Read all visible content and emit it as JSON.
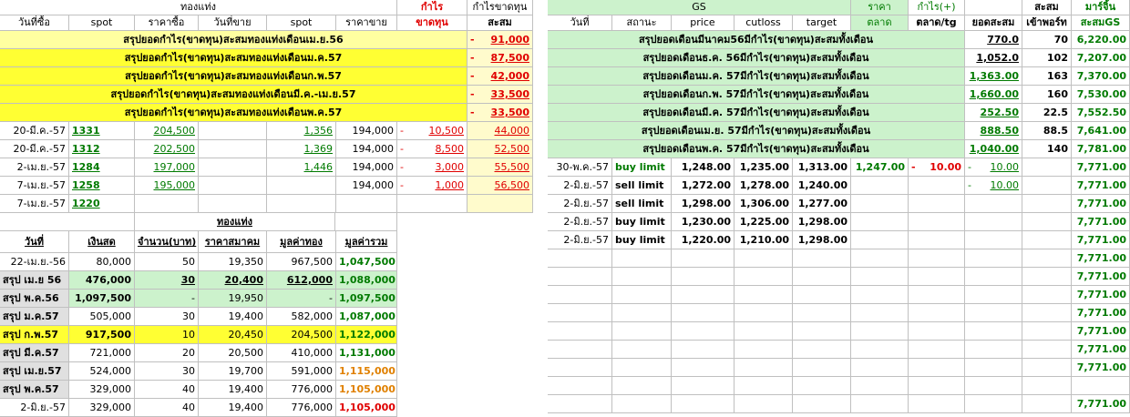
{
  "header": {
    "gold_bar": "ทองแท่ง",
    "profit": "กำไร",
    "profit_loss": "กำไรขาดทุน",
    "gs": "GS",
    "price": "ราคา",
    "profit_plus": "กำไร(+)",
    "accumulate": "สะสม",
    "margin": "มาร์จิ้น",
    "buy_date": "วันที่ซื้อ",
    "spot": "spot",
    "buy_price": "ราคาซื้อ",
    "sell_date": "วันที่ขาย",
    "spot2": "spot",
    "sell_price": "ราคาขาย",
    "loss": "ขาดทุน",
    "accum": "สะสม",
    "date": "วันที่",
    "status": "สถานะ",
    "price_en": "price",
    "cutloss": "cutloss",
    "target": "target",
    "market": "ตลาด",
    "market_tg": "ตลาด/tg",
    "total_accum": "ยอดสะสม",
    "entry_port": "เข้าพอร์ท",
    "accum_gs": "สะสมGS"
  },
  "left_summary": [
    {
      "text": "สรุปยอดกำไร(ขาดทุน)สะสมทองแท่งเดือนเม.ย.56",
      "sign": "-",
      "value": "91,000"
    },
    {
      "text": "สรุปยอดกำไร(ขาดทุน)สะสมทองแท่งเดือนม.ค.57",
      "sign": "-",
      "value": "87,500"
    },
    {
      "text": "สรุปยอดกำไร(ขาดทุน)สะสมทองแท่งเดือนก.พ.57",
      "sign": "-",
      "value": "42,000"
    },
    {
      "text": "สรุปยอดกำไร(ขาดทุน)สะสมทองแท่งเดือนมี.ค.-เม.ย.57",
      "sign": "-",
      "value": "33,500"
    },
    {
      "text": "สรุปยอดกำไร(ขาดทุน)สะสมทองแท่งเดือนพ.ค.57",
      "sign": "-",
      "value": "33,500"
    }
  ],
  "left_trades": [
    {
      "date": "20-มี.ค.-57",
      "spot": "1331",
      "buy": "204,500",
      "sell_date": "",
      "spot2": "1,356",
      "sell": "194,000",
      "sign": "-",
      "pl": "10,500",
      "acc": "44,000"
    },
    {
      "date": "20-มี.ค.-57",
      "spot": "1312",
      "buy": "202,500",
      "sell_date": "",
      "spot2": "1,369",
      "sell": "194,000",
      "sign": "-",
      "pl": "8,500",
      "acc": "52,500"
    },
    {
      "date": "2-เม.ย.-57",
      "spot": "1284",
      "buy": "197,000",
      "sell_date": "",
      "spot2": "1,446",
      "sell": "194,000",
      "sign": "-",
      "pl": "3,000",
      "acc": "55,500"
    },
    {
      "date": "7-เม.ย.-57",
      "spot": "1258",
      "buy": "195,000",
      "sell_date": "",
      "spot2": "",
      "sell": "194,000",
      "sign": "-",
      "pl": "1,000",
      "acc": "56,500"
    },
    {
      "date": "7-เม.ย.-57",
      "spot": "1220",
      "buy": "",
      "sell_date": "",
      "spot2": "",
      "sell": "",
      "sign": "",
      "pl": "",
      "acc": ""
    }
  ],
  "portfolio": {
    "title": "ทองแท่ง",
    "headers": [
      "วันที่",
      "เงินสด",
      "จำนวน(บาท)",
      "ราคาสมาคม",
      "มูลค่าทอง",
      "มูลค่ารวม"
    ],
    "rows": [
      {
        "label": "22-เม.ย.-56",
        "cash": "80,000",
        "qty": "50",
        "price": "19,350",
        "gold": "967,500",
        "total": "1,047,500"
      },
      {
        "label": "สรุป เม.ย 56",
        "cash": "476,000",
        "qty": "30",
        "price": "20,400",
        "gold": "612,000",
        "total": "1,088,000"
      },
      {
        "label": "สรุป พ.ค.56",
        "cash": "1,097,500",
        "qty": "-",
        "price": "19,950",
        "gold": "-",
        "total": "1,097,500"
      },
      {
        "label": "สรุป ม.ค.57",
        "cash": "505,000",
        "qty": "30",
        "price": "19,400",
        "gold": "582,000",
        "total": "1,087,000"
      },
      {
        "label": "สรุป ก.พ.57",
        "cash": "917,500",
        "qty": "10",
        "price": "20,450",
        "gold": "204,500",
        "total": "1,122,000"
      },
      {
        "label": "สรุป มี.ค.57",
        "cash": "721,000",
        "qty": "20",
        "price": "20,500",
        "gold": "410,000",
        "total": "1,131,000"
      },
      {
        "label": "สรุป เม.ย.57",
        "cash": "524,000",
        "qty": "30",
        "price": "19,700",
        "gold": "591,000",
        "total": "1,115,000"
      },
      {
        "label": "สรุป พ.ค.57",
        "cash": "329,000",
        "qty": "40",
        "price": "19,400",
        "gold": "776,000",
        "total": "1,105,000"
      },
      {
        "label": "2-มิ.ย.-57",
        "cash": "329,000",
        "qty": "40",
        "price": "19,400",
        "gold": "776,000",
        "total": "1,105,000"
      }
    ]
  },
  "right_summary": [
    {
      "text": "สรุปยอดเดือนมีนาคม56มีกำไร(ขาดทุน)สะสมทั้งเดือน",
      "total": "770.0",
      "entry": "70",
      "gs": "6,220.00"
    },
    {
      "text": "สรุปยอดเดือนธ.ค. 56มีกำไร(ขาดทุน)สะสมทั้งเดือน",
      "total": "1,052.0",
      "entry": "102",
      "gs": "7,207.00"
    },
    {
      "text": "สรุปยอดเดือนม.ค. 57มีกำไร(ขาดทุน)สะสมทั้งเดือน",
      "total": "1,363.00",
      "entry": "163",
      "gs": "7,370.00"
    },
    {
      "text": "สรุปยอดเดือนก.พ. 57มีกำไร(ขาดทุน)สะสมทั้งเดือน",
      "total": "1,660.00",
      "entry": "160",
      "gs": "7,530.00"
    },
    {
      "text": "สรุปยอดเดือนมี.ค. 57มีกำไร(ขาดทุน)สะสมทั้งเดือน",
      "total": "252.50",
      "entry": "22.5",
      "gs": "7,552.50"
    },
    {
      "text": "สรุปยอดเดือนเม.ย. 57มีกำไร(ขาดทุน)สะสมทั้งเดือน",
      "total": "888.50",
      "entry": "88.5",
      "gs": "7,641.00"
    },
    {
      "text": "สรุปยอดเดือนพ.ค. 57มีกำไร(ขาดทุน)สะสมทั้งเดือน",
      "total": "1,040.00",
      "entry": "140",
      "gs": "7,781.00"
    }
  ],
  "right_orders": [
    {
      "date": "30-พ.ค.-57",
      "status": "buy limit",
      "price": "1,248.00",
      "cutloss": "1,235.00",
      "target": "1,313.00",
      "market": "1,247.00",
      "sign": "-",
      "mtg": "10.00",
      "sign2": "-",
      "total": "10.00",
      "gs": "7,771.00"
    },
    {
      "date": "2-มิ.ย.-57",
      "status": "sell limit",
      "price": "1,272.00",
      "cutloss": "1,278.00",
      "target": "1,240.00",
      "market": "",
      "sign": "",
      "mtg": "",
      "sign2": "-",
      "total": "10.00",
      "gs": "7,771.00"
    },
    {
      "date": "2-มิ.ย.-57",
      "status": "sell limit",
      "price": "1,298.00",
      "cutloss": "1,306.00",
      "target": "1,277.00",
      "market": "",
      "sign": "",
      "mtg": "",
      "sign2": "",
      "total": "",
      "gs": "7,771.00"
    },
    {
      "date": "2-มิ.ย.-57",
      "status": "buy limit",
      "price": "1,230.00",
      "cutloss": "1,225.00",
      "target": "1,298.00",
      "market": "",
      "sign": "",
      "mtg": "",
      "sign2": "",
      "total": "",
      "gs": "7,771.00"
    },
    {
      "date": "2-มิ.ย.-57",
      "status": "buy limit",
      "price": "1,220.00",
      "cutloss": "1,210.00",
      "target": "1,298.00",
      "market": "",
      "sign": "",
      "mtg": "",
      "sign2": "",
      "total": "",
      "gs": "7,771.00"
    }
  ],
  "right_gs_tail": [
    "7,771.00",
    "7,771.00",
    "7,771.00",
    "7,771.00",
    "7,771.00",
    "7,771.00",
    "7,771.00",
    "7,771.00",
    "7,771.00"
  ]
}
